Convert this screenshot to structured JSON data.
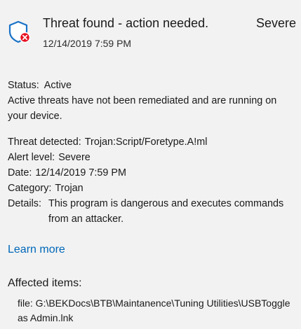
{
  "header": {
    "title": "Threat found - action needed.",
    "severity": "Severe",
    "timestamp": "12/14/2019 7:59 PM",
    "icon": "shield-error-icon",
    "accent_color": "#1a73c7",
    "error_color": "#e81123"
  },
  "status": {
    "label": "Status:",
    "value": "Active",
    "description": "Active threats have not been remediated and are running on your device."
  },
  "details": {
    "threat_label": "Threat detected:",
    "threat_value": "Trojan:Script/Foretype.A!ml",
    "alert_label": "Alert level:",
    "alert_value": "Severe",
    "date_label": "Date:",
    "date_value": "12/14/2019 7:59 PM",
    "category_label": "Category:",
    "category_value": "Trojan",
    "details_label": "Details:",
    "details_value": "This program is dangerous and executes commands from an attacker."
  },
  "learn_more": "Learn more",
  "affected": {
    "title": "Affected items:",
    "items": [
      "file: G:\\BEKDocs\\BTB\\Maintanence\\Tuning Utilities\\USBToggle as Admin.lnk"
    ]
  }
}
